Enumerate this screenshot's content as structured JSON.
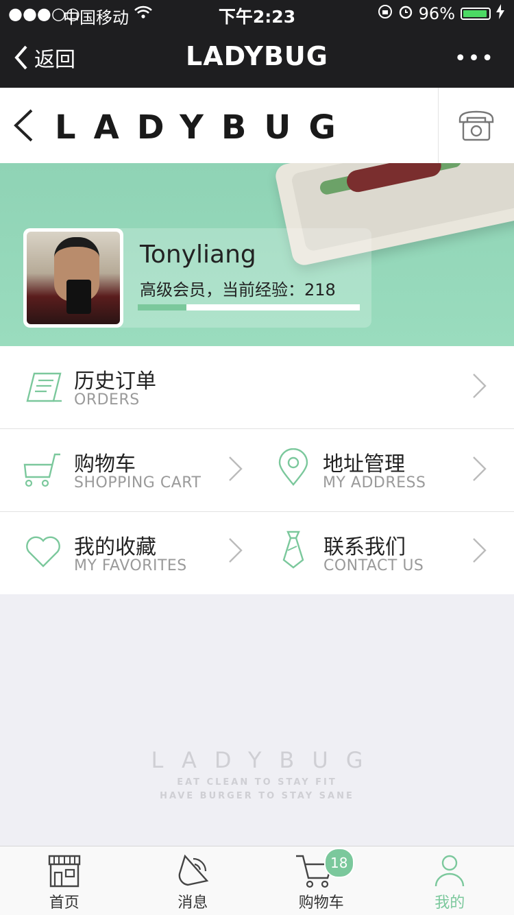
{
  "status_bar": {
    "signal": "●●●○○",
    "carrier": "中国移动",
    "time": "下午2:23",
    "battery_text": "96%",
    "battery_level": 0.96
  },
  "nav": {
    "back_label": "返回",
    "title": "LADYBUG",
    "more_label": "•••"
  },
  "brand": {
    "logo_text": "LADYBUG"
  },
  "profile": {
    "username": "Tonyliang",
    "level_text": "高级会员，当前经验：218",
    "xp_progress": 0.22
  },
  "menu": {
    "orders": {
      "zh": "历史订单",
      "en": "ORDERS"
    },
    "cart": {
      "zh": "购物车",
      "en": "SHOPPING CART"
    },
    "address": {
      "zh": "地址管理",
      "en": "MY ADDRESS"
    },
    "favorites": {
      "zh": "我的收藏",
      "en": "MY FAVORITES"
    },
    "contact": {
      "zh": "联系我们",
      "en": "CONTACT US"
    }
  },
  "footer": {
    "logo": "LADYBUG",
    "tagline_1": "EAT CLEAN TO STAY FIT",
    "tagline_2": "HAVE BURGER TO STAY SANE"
  },
  "tabs": [
    {
      "label": "首页",
      "icon": "store-icon"
    },
    {
      "label": "消息",
      "icon": "message-icon"
    },
    {
      "label": "购物车",
      "icon": "cart-icon",
      "badge": "18"
    },
    {
      "label": "我的",
      "icon": "user-icon",
      "active": true
    }
  ],
  "colors": {
    "accent": "#7bc89c",
    "banner": "#93d6b8",
    "topbar": "#1e1e20"
  }
}
